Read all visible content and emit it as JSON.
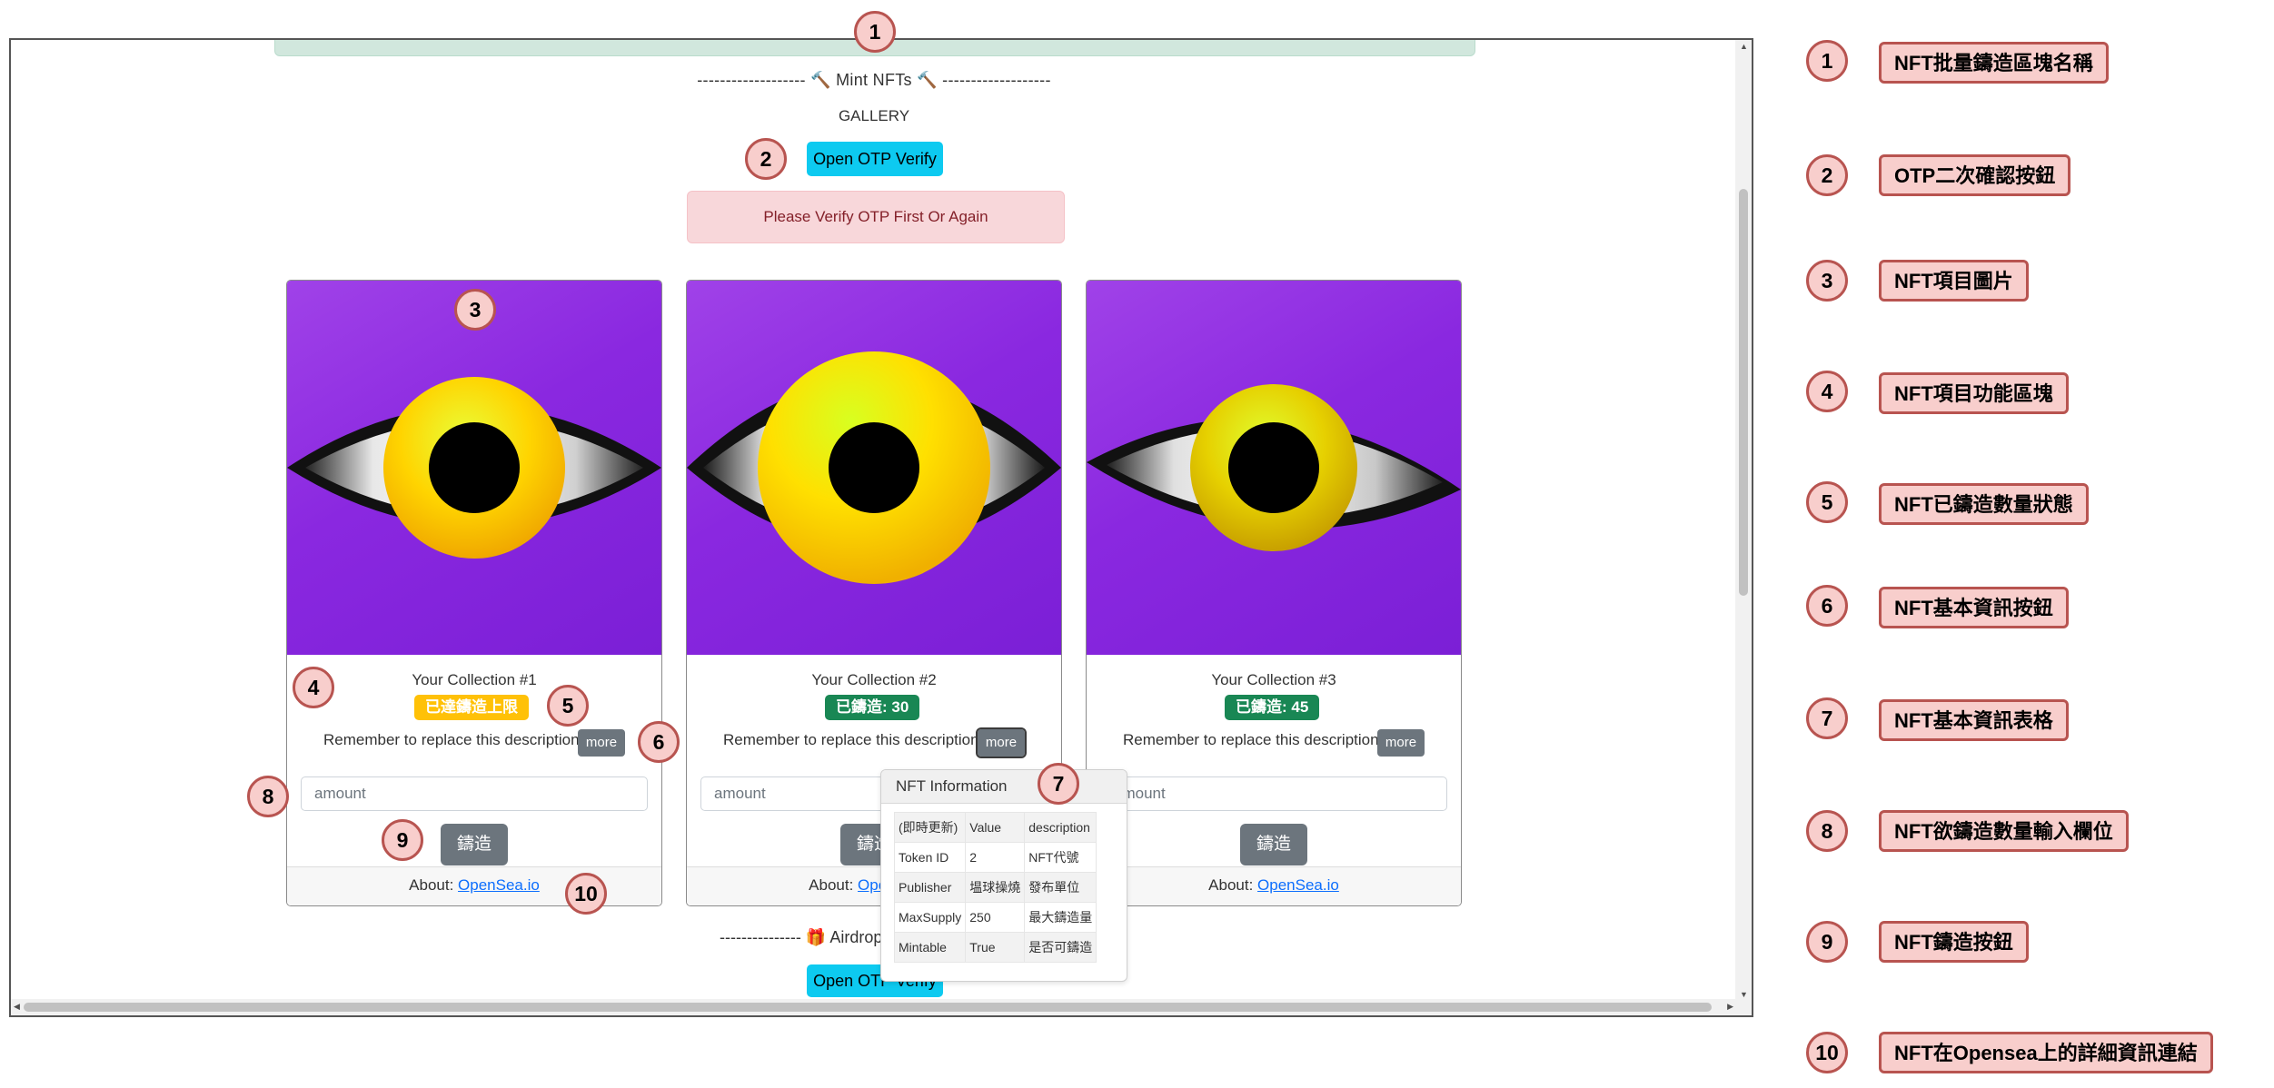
{
  "page": {
    "mint_section_title": "------------------- 🔨 Mint NFTs 🔨 -------------------",
    "gallery_label": "GALLERY",
    "otp_button_label": "Open OTP Verify",
    "otp_warning": "Please Verify OTP First Or Again",
    "airdrop_section_title": "--------------- 🎁 Airdrop",
    "bottom_otp_button_label": "Open OTP Verify"
  },
  "cards": [
    {
      "title": "Your Collection #1",
      "status_badge": "已達鑄造上限",
      "status_color": "#ffc107",
      "description": "Remember to replace this description",
      "more_label": "more",
      "amount_placeholder": "amount",
      "mint_label": "鑄造",
      "about_label": "About:",
      "about_link": "OpenSea.io"
    },
    {
      "title": "Your Collection #2",
      "status_badge": "已鑄造: 30",
      "status_color": "#198754",
      "description": "Remember to replace this description",
      "more_label": "more",
      "amount_placeholder": "amount",
      "mint_label": "鑄造",
      "about_label": "About:",
      "about_link": "OpenSea.io"
    },
    {
      "title": "Your Collection #3",
      "status_badge": "已鑄造: 45",
      "status_color": "#198754",
      "description": "Remember to replace this description",
      "more_label": "more",
      "amount_placeholder": "amount",
      "mint_label": "鑄造",
      "about_label": "About:",
      "about_link": "OpenSea.io"
    }
  ],
  "popover": {
    "title": "NFT Information",
    "headers": [
      "(即時更新)",
      "Value",
      "description"
    ],
    "rows": [
      [
        "Token ID",
        "2",
        "NFT代號"
      ],
      [
        "Publisher",
        "塭球操燒",
        "發布單位"
      ],
      [
        "MaxSupply",
        "250",
        "最大鑄造量"
      ],
      [
        "Mintable",
        "True",
        "是否可鑄造"
      ]
    ]
  },
  "annotations": [
    "1",
    "2",
    "3",
    "4",
    "5",
    "6",
    "7",
    "8",
    "9",
    "10"
  ],
  "legend": [
    {
      "num": "1",
      "label": "NFT批量鑄造區塊名稱"
    },
    {
      "num": "2",
      "label": "OTP二次確認按鈕"
    },
    {
      "num": "3",
      "label": "NFT項目圖片"
    },
    {
      "num": "4",
      "label": "NFT項目功能區塊"
    },
    {
      "num": "5",
      "label": "NFT已鑄造數量狀態"
    },
    {
      "num": "6",
      "label": "NFT基本資訊按鈕"
    },
    {
      "num": "7",
      "label": "NFT基本資訊表格"
    },
    {
      "num": "8",
      "label": "NFT欲鑄造數量輸入欄位"
    },
    {
      "num": "9",
      "label": "NFT鑄造按鈕"
    },
    {
      "num": "10",
      "label": "NFT在Opensea上的詳細資訊連結"
    }
  ],
  "colors": {
    "accent_info": "#0dcaf0",
    "annotation_fill": "#f8cecc",
    "annotation_border": "#b85450",
    "card_art": "#8a28e0"
  }
}
